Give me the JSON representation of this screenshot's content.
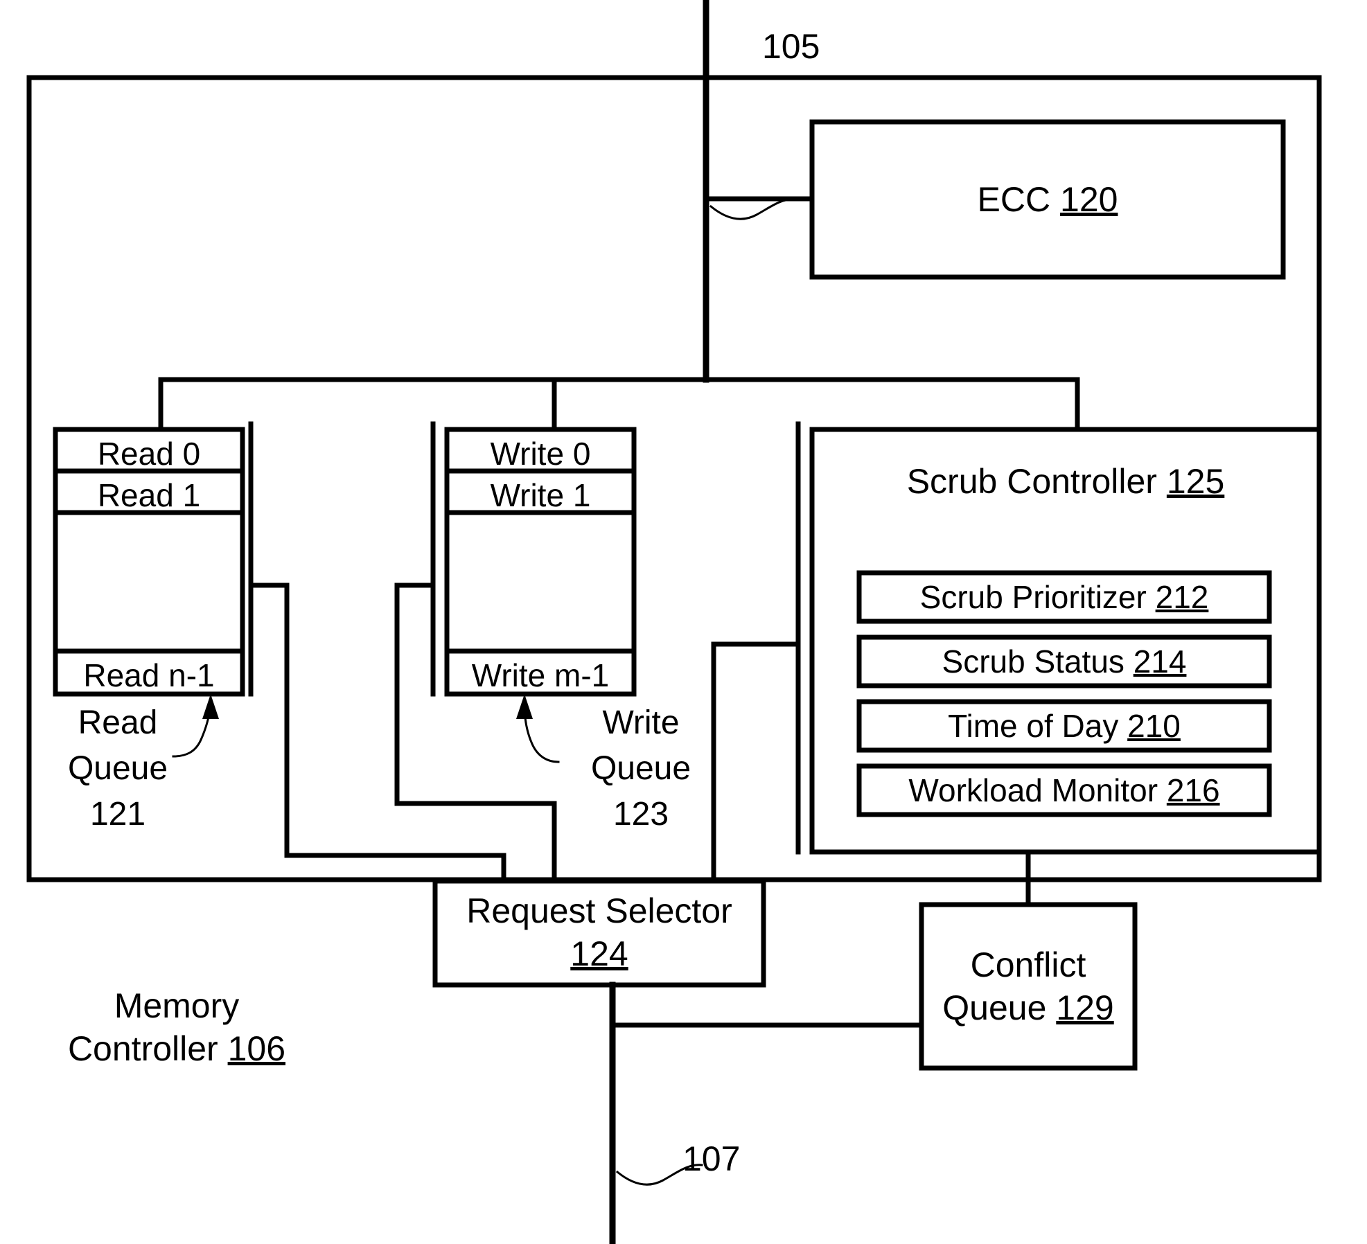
{
  "figure": {
    "type": "block-diagram",
    "domain": "patent-figure",
    "ink_color": "#000000",
    "background_color": "#ffffff"
  },
  "bus_labels": {
    "top": "105",
    "bottom": "107"
  },
  "outer": {
    "label_line1": "Memory",
    "label_line2_text": "Controller ",
    "label_line2_ref": "106"
  },
  "ecc": {
    "text": "ECC ",
    "ref": "120"
  },
  "read_queue": {
    "entries": [
      "Read 0",
      "Read 1",
      "",
      "Read n-1"
    ],
    "caption_line1": "Read",
    "caption_line2": "Queue",
    "caption_line3": "121"
  },
  "write_queue": {
    "entries": [
      "Write 0",
      "Write 1",
      "",
      "Write m-1"
    ],
    "caption_line1": "Write",
    "caption_line2": "Queue",
    "caption_line3": "123"
  },
  "scrub_controller": {
    "title_text": "Scrub Controller ",
    "title_ref": "125",
    "modules": [
      {
        "text": "Scrub Prioritizer ",
        "ref": "212"
      },
      {
        "text": "Scrub Status ",
        "ref": "214"
      },
      {
        "text": "Time of Day ",
        "ref": "210"
      },
      {
        "text": "Workload Monitor ",
        "ref": "216"
      }
    ]
  },
  "request_selector": {
    "line1": "Request Selector",
    "ref": "124"
  },
  "conflict_queue": {
    "line1": "Conflict",
    "line2_text": "Queue ",
    "line2_ref": "129"
  }
}
